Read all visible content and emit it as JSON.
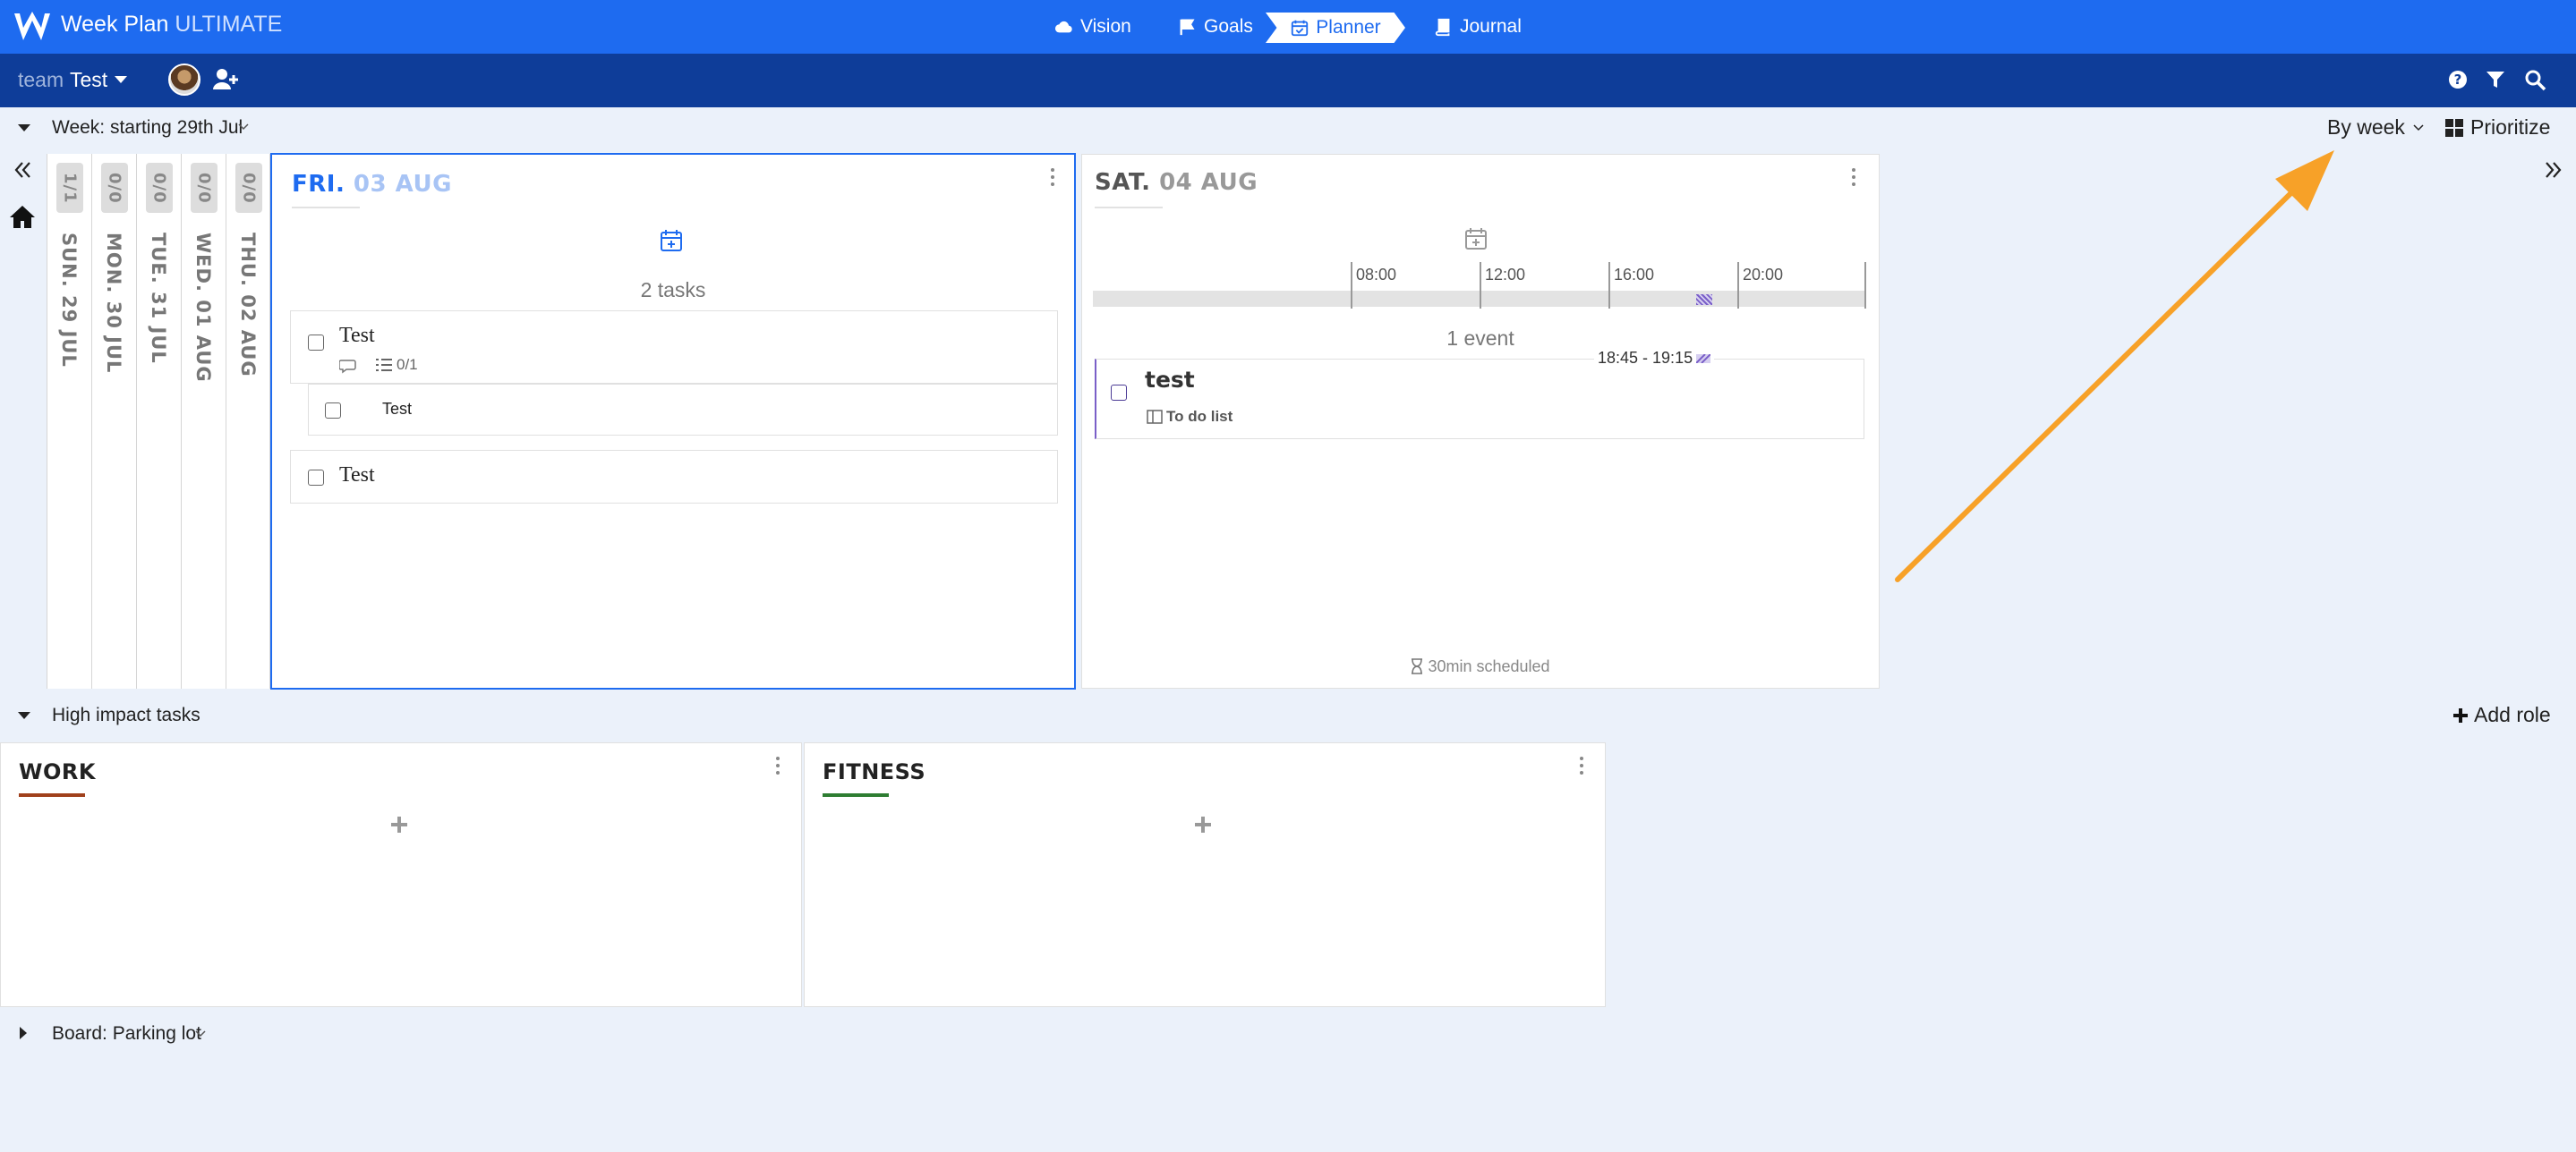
{
  "app": {
    "title_main": "Week Plan",
    "title_edition": "ULTIMATE"
  },
  "nav": [
    {
      "label": "Vision",
      "icon": "cloud-icon"
    },
    {
      "label": "Goals",
      "icon": "flag-icon"
    },
    {
      "label": "Planner",
      "icon": "calendar-check-icon",
      "active": true
    },
    {
      "label": "Journal",
      "icon": "book-icon"
    }
  ],
  "teambar": {
    "team_label": "team",
    "team_name": "Test"
  },
  "week": {
    "label": "Week: starting 29th Jul",
    "view_mode": "By week",
    "prioritize": "Prioritize"
  },
  "collapsed_days": [
    {
      "count": "1/1",
      "date": "SUN. 29 JUL"
    },
    {
      "count": "0/0",
      "date": "MON. 30 JUL"
    },
    {
      "count": "0/0",
      "date": "TUE. 31 JUL"
    },
    {
      "count": "0/0",
      "date": "WED. 01 AUG"
    },
    {
      "count": "0/0",
      "date": "THU. 02 AUG"
    }
  ],
  "friday": {
    "dow": "FRI.",
    "date": "03 AUG",
    "tasks_count": "2 tasks",
    "tasks": [
      {
        "title": "Test",
        "subtask_count": "0/1",
        "subtasks": [
          "Test"
        ]
      },
      {
        "title": "Test"
      }
    ]
  },
  "saturday": {
    "dow": "SAT.",
    "date": "04 AUG",
    "timeline_labels": [
      "08:00",
      "12:00",
      "16:00",
      "20:00"
    ],
    "events_count": "1 event",
    "event": {
      "title": "test",
      "time": "18:45 - 19:15",
      "board": "To do list"
    },
    "scheduled": "30min scheduled"
  },
  "high_impact": {
    "label": "High impact tasks",
    "add_role": "Add role",
    "roles": [
      {
        "name": "WORK",
        "color": "#a0401c"
      },
      {
        "name": "FITNESS",
        "color": "#2e7d32"
      }
    ]
  },
  "board": {
    "label": "Board: Parking lot"
  },
  "colors": {
    "primary": "#1e6bf0",
    "secondary_bar": "#0e3d99",
    "annotation_arrow": "#f7a128"
  }
}
